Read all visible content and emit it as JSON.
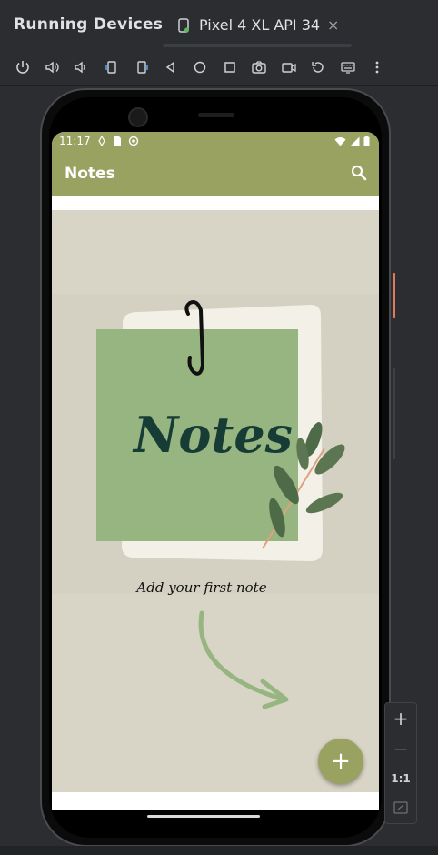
{
  "panel": {
    "title": "Running Devices"
  },
  "device_tab": {
    "label": "Pixel 4 XL API 34",
    "close": "×"
  },
  "toolbar": {
    "icons": [
      "power-icon",
      "volume-up-icon",
      "volume-down-icon",
      "rotate-left-icon",
      "rotate-right-icon",
      "back-icon",
      "home-icon",
      "overview-icon",
      "camera-icon",
      "screenrecord-icon",
      "reset-icon",
      "keyboard-icon",
      "more-icon"
    ]
  },
  "statusbar": {
    "time": "11:17"
  },
  "app": {
    "title": "Notes",
    "illustration_text": "Notes",
    "empty_message": "Add your first note",
    "fab_label": "+"
  },
  "zoom": {
    "plus": "+",
    "minus": "—",
    "fit": "1:1"
  },
  "colors": {
    "app_primary": "#9aa262",
    "ide_bg": "#2b2d30",
    "accent_button": "#e0795d"
  }
}
